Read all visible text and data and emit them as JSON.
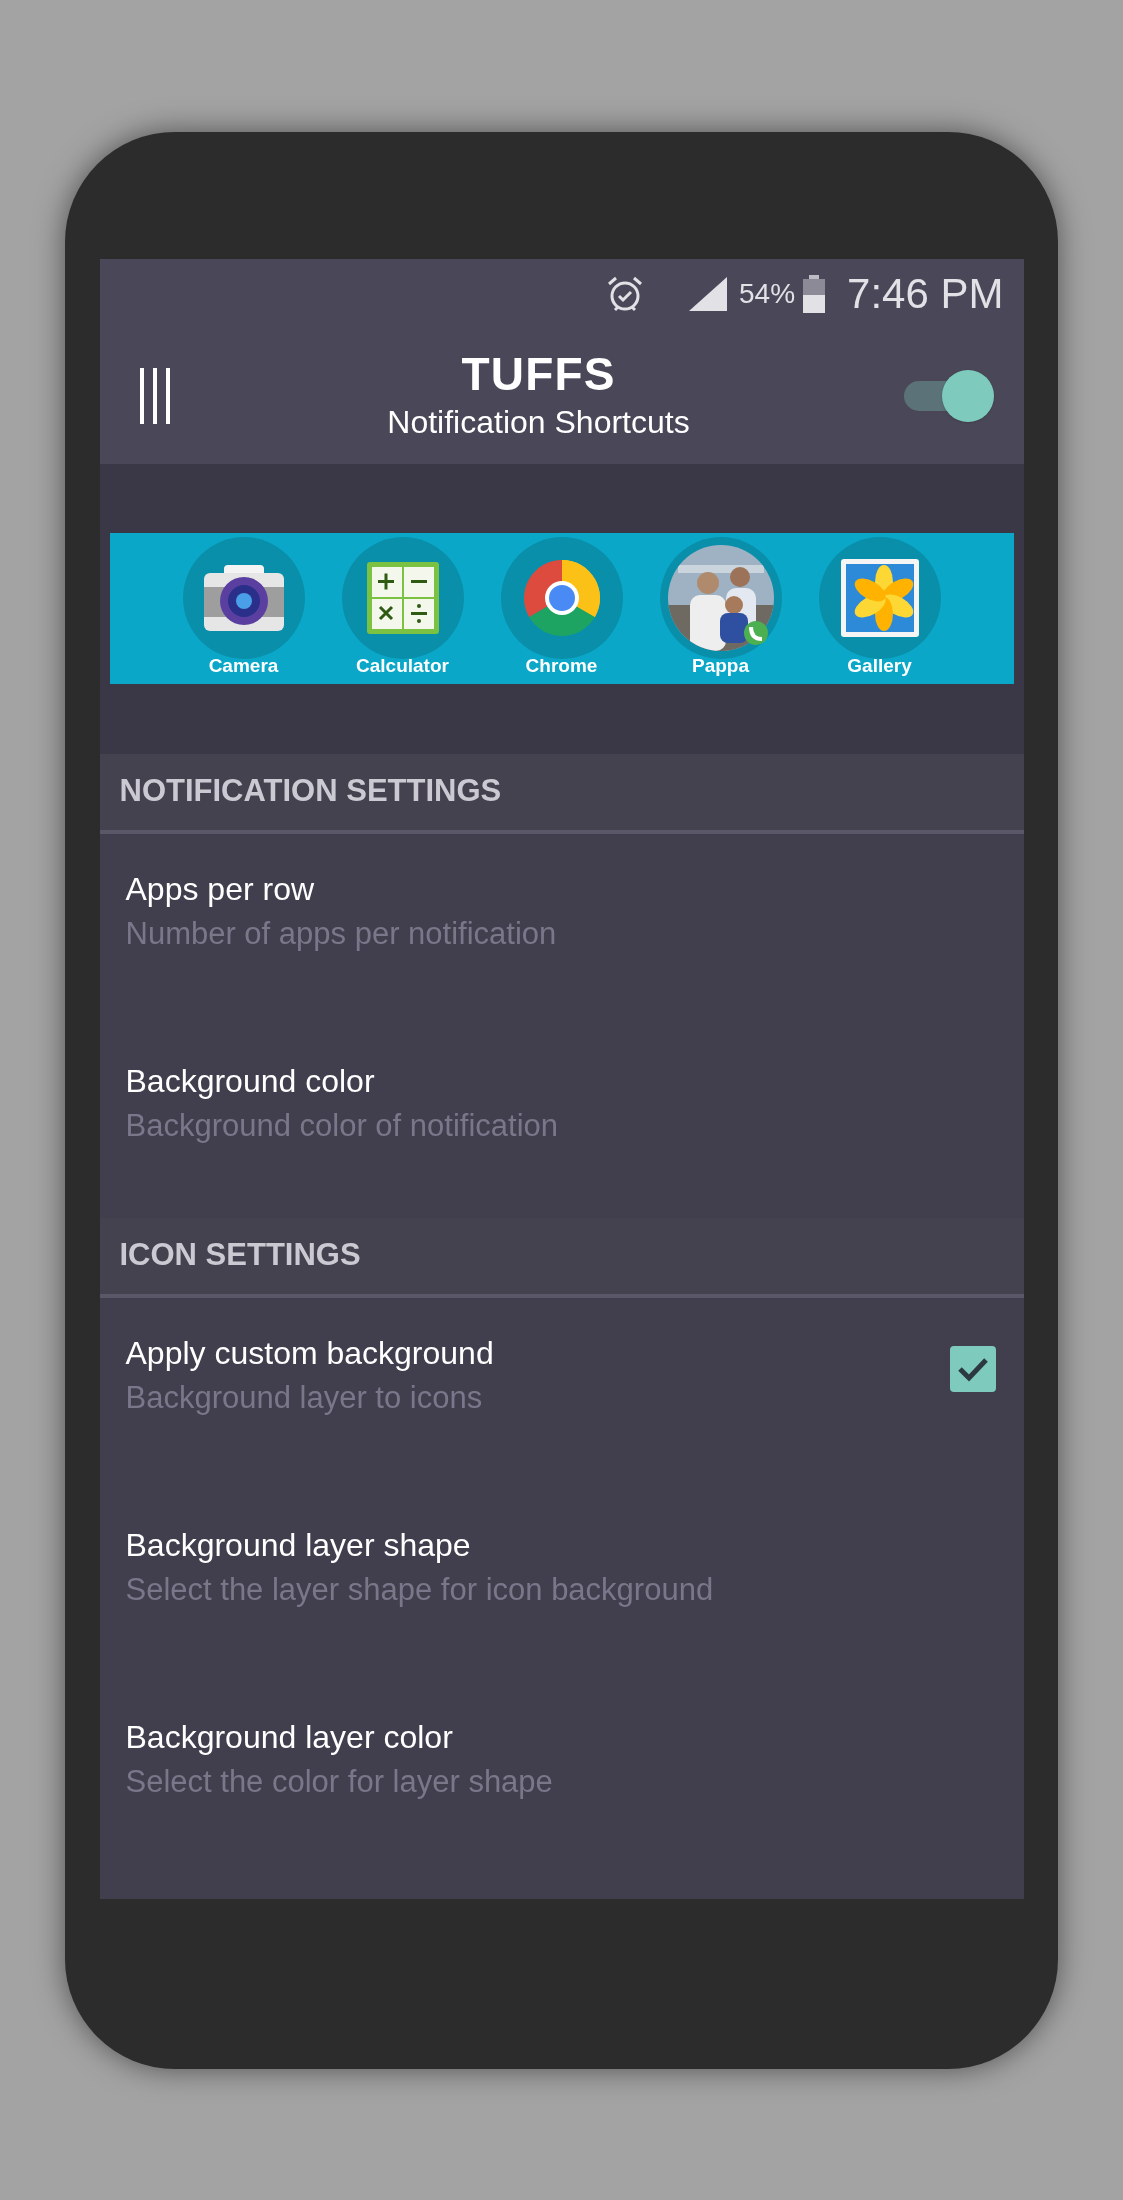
{
  "status_bar": {
    "battery": "54%",
    "time": "7:46 PM"
  },
  "toolbar": {
    "title": "TUFFS",
    "subtitle": "Notification Shortcuts",
    "switch": {
      "on": true
    }
  },
  "shortcuts": [
    {
      "kind": "camera",
      "label": "Camera"
    },
    {
      "kind": "calculator",
      "label": "Calculator"
    },
    {
      "kind": "chrome",
      "label": "Chrome"
    },
    {
      "kind": "contact",
      "label": "Pappa"
    },
    {
      "kind": "gallery",
      "label": "Gallery"
    }
  ],
  "sections": [
    {
      "title": "NOTIFICATION SETTINGS",
      "items": [
        {
          "kind": "plain",
          "title": "Apps per row",
          "summary": "Number of apps per notification"
        },
        {
          "kind": "plain",
          "title": "Background color",
          "summary": "Background color of notification"
        }
      ]
    },
    {
      "title": "ICON SETTINGS",
      "items": [
        {
          "kind": "checkbox",
          "checked": true,
          "title": "Apply custom background",
          "summary": "Background layer to icons"
        },
        {
          "kind": "plain",
          "title": "Background layer shape",
          "summary": "Select the layer shape for icon background"
        },
        {
          "kind": "plain",
          "title": "Background layer color",
          "summary": "Select the color for layer shape"
        }
      ]
    }
  ]
}
